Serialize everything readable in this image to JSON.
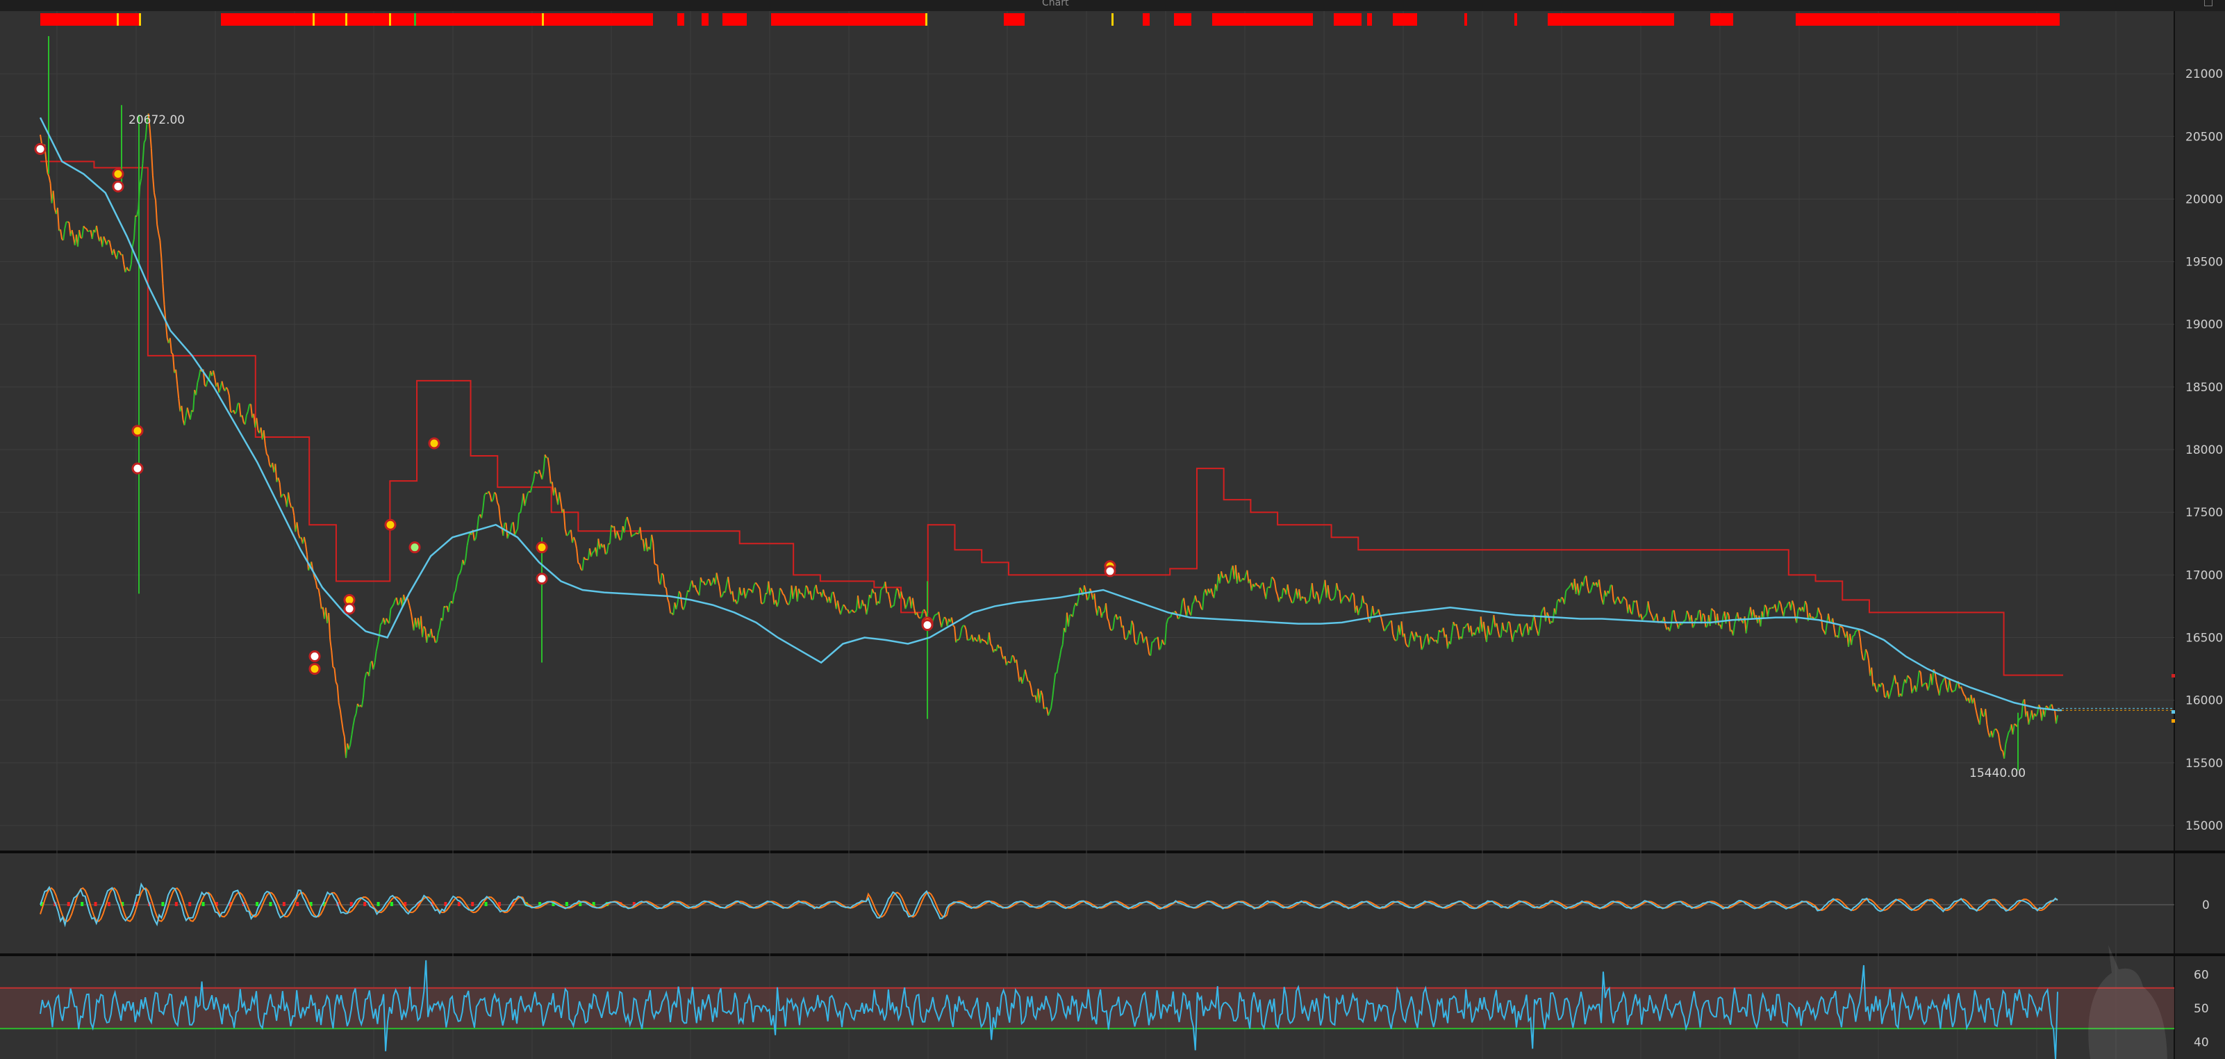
{
  "window": {
    "title": "Chart"
  },
  "price_panel": {
    "high_label": "20672.00",
    "low_label": "15440.00",
    "ticks": [
      "21000",
      "20500",
      "20000",
      "19500",
      "19000",
      "18500",
      "18000",
      "17500",
      "17000",
      "16500",
      "16000",
      "15500",
      "15000"
    ]
  },
  "oscillator_panel": {
    "ticks": [
      "0"
    ]
  },
  "rsi_panel": {
    "ticks": [
      "60",
      "50",
      "40"
    ]
  },
  "colors": {
    "background": "#323232",
    "grid": "#3e3e3e",
    "axis_bg": "#2a2a2a",
    "price_up": "#2bbd2b",
    "price_down": "#ff7a1a",
    "moving_average": "#5fc6e8",
    "trailing_stop": "#d42020",
    "signal_bar": "#ff0000",
    "signal_mark": "#ffd000",
    "rsi_line": "#39b6e6"
  },
  "chart_data": [
    {
      "type": "line",
      "panel": "price",
      "yticks": [
        21000,
        20500,
        20000,
        19500,
        19000,
        18500,
        18000,
        17500,
        17000,
        16500,
        16000,
        15500,
        15000
      ],
      "ylim": [
        14800,
        21500
      ],
      "annotations": [
        {
          "label": "20672.00",
          "value": 20672
        },
        {
          "label": "15440.00",
          "value": 15440
        }
      ],
      "series": [
        {
          "values": [
            20500,
            19800,
            19700,
            19750,
            19600,
            19450,
            20672,
            19000,
            18200,
            18600,
            18500,
            18300,
            18250,
            17800,
            17500,
            17100,
            16600,
            15600,
            16100,
            16600,
            16800,
            16600,
            16500,
            16900,
            17300,
            17700,
            17300,
            17600,
            17900,
            17500,
            17100,
            17200,
            17350,
            17400,
            17200,
            16700,
            16850,
            16950,
            16900,
            16850,
            16880,
            16800,
            16850,
            16880,
            16820,
            16700,
            16800,
            16850,
            16800,
            16700,
            16650,
            16550,
            16500,
            16450,
            16300,
            16100,
            15900,
            16600,
            16900,
            16700,
            16600,
            16500,
            16400,
            16700,
            16750,
            16900,
            17000,
            16950,
            16900,
            16850,
            16800,
            16850,
            16850,
            16780,
            16700,
            16600,
            16500,
            16450,
            16500,
            16550,
            16560,
            16580,
            16560,
            16600,
            16700,
            16900,
            16950,
            16850,
            16780,
            16700,
            16650,
            16640,
            16650,
            16640,
            16620,
            16650,
            16700,
            16750,
            16700,
            16620,
            16550,
            16500,
            16050,
            16100,
            16150,
            16150,
            16100,
            16000,
            15850,
            15600,
            15900,
            15900,
            15920
          ]
        },
        {
          "values": [
            20650,
            20300,
            20200,
            20050,
            19700,
            19300,
            18950,
            18750,
            18500,
            18200,
            17900,
            17550,
            17200,
            16900,
            16700,
            16550,
            16500,
            16850,
            17150,
            17300,
            17350,
            17400,
            17300,
            17100,
            16950,
            16880,
            16860,
            16850,
            16840,
            16830,
            16800,
            16760,
            16700,
            16620,
            16500,
            16400,
            16300,
            16450,
            16500,
            16480,
            16450,
            16500,
            16600,
            16700,
            16750,
            16780,
            16800,
            16820,
            16850,
            16880,
            16820,
            16760,
            16700,
            16660,
            16650,
            16640,
            16630,
            16620,
            16610,
            16610,
            16620,
            16650,
            16680,
            16700,
            16720,
            16740,
            16720,
            16700,
            16680,
            16670,
            16660,
            16650,
            16650,
            16640,
            16630,
            16620,
            16620,
            16620,
            16640,
            16650,
            16660,
            16660,
            16640,
            16600,
            16560,
            16480,
            16350,
            16250,
            16170,
            16100,
            16040,
            15980,
            15940,
            15920
          ]
        },
        {
          "values": [
            20300,
            20300,
            20250,
            20250,
            18750,
            18750,
            18750,
            18750,
            18100,
            18100,
            17400,
            16950,
            16950,
            17750,
            18550,
            18550,
            17950,
            17700,
            17700,
            17500,
            17350,
            17350,
            17350,
            17350,
            17350,
            17350,
            17250,
            17250,
            17000,
            16950,
            16950,
            16900,
            16700,
            17400,
            17200,
            17100,
            17000,
            17000,
            17000,
            17000,
            17000,
            17000,
            17050,
            17850,
            17600,
            17500,
            17400,
            17400,
            17300,
            17200,
            17200,
            17200,
            17200,
            17200,
            17200,
            17200,
            17200,
            17200,
            17200,
            17200,
            17200,
            17200,
            17200,
            17200,
            17200,
            17000,
            16950,
            16800,
            16700,
            16700,
            16700,
            16700,
            16700,
            16200,
            16200,
            16200
          ]
        }
      ]
    },
    {
      "type": "line",
      "panel": "oscillator",
      "yticks": [
        0
      ],
      "ylim": [
        -1,
        1
      ]
    },
    {
      "type": "line",
      "panel": "rsi",
      "yticks": [
        60,
        50,
        40
      ],
      "ylim": [
        35,
        65
      ]
    }
  ]
}
